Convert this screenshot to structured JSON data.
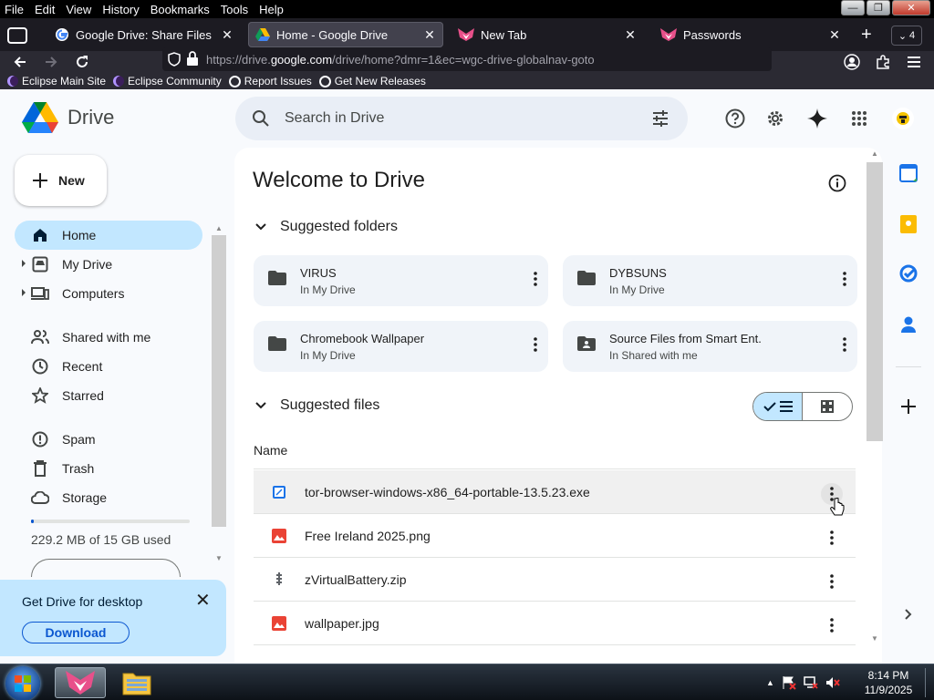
{
  "menubar": {
    "items": [
      "File",
      "Edit",
      "View",
      "History",
      "Bookmarks",
      "Tools",
      "Help"
    ]
  },
  "tabs": [
    {
      "title": "Google Drive: Share Files Online",
      "active": false
    },
    {
      "title": "Home - Google Drive",
      "active": true
    },
    {
      "title": "New Tab",
      "active": false
    },
    {
      "title": "Passwords",
      "active": false
    }
  ],
  "tab_count": "4",
  "urlbar": {
    "url_prefix": "https://drive.",
    "url_domain": "google.com",
    "url_rest": "/drive/home?dmr=1&ec=wgc-drive-globalnav-goto"
  },
  "bookmarks": [
    "Eclipse Main Site",
    "Eclipse Community",
    "Report Issues",
    "Get New Releases"
  ],
  "drive": {
    "logo_text": "Drive",
    "search_placeholder": "Search in Drive",
    "new_label": "New",
    "nav": [
      {
        "label": "Home",
        "icon": "home-icon",
        "selected": true
      },
      {
        "label": "My Drive",
        "icon": "my-drive-icon",
        "expandable": true
      },
      {
        "label": "Computers",
        "icon": "computers-icon",
        "expandable": true
      },
      {
        "label": "Shared with me",
        "icon": "shared-icon"
      },
      {
        "label": "Recent",
        "icon": "clock-icon"
      },
      {
        "label": "Starred",
        "icon": "star-icon"
      },
      {
        "label": "Spam",
        "icon": "spam-icon"
      },
      {
        "label": "Trash",
        "icon": "trash-icon"
      },
      {
        "label": "Storage",
        "icon": "cloud-icon"
      }
    ],
    "storage_text": "229.2 MB of 15 GB used",
    "storage_fraction": 0.015,
    "promo": {
      "title": "Get Drive for desktop",
      "download_label": "Download"
    },
    "welcome": "Welcome to Drive",
    "suggested_folders_label": "Suggested folders",
    "folders": [
      {
        "name": "VIRUS",
        "location": "In My Drive",
        "icon": "folder-icon"
      },
      {
        "name": "DYBSUNS",
        "location": "In My Drive",
        "icon": "folder-icon"
      },
      {
        "name": "Chromebook Wallpaper",
        "location": "In My Drive",
        "icon": "folder-icon"
      },
      {
        "name": "Source Files from Smart Ent.",
        "location": "In Shared with me",
        "icon": "shared-folder-icon"
      }
    ],
    "suggested_files_label": "Suggested files",
    "column_name": "Name",
    "files": [
      {
        "name": "tor-browser-windows-x86_64-portable-13.5.23.exe",
        "icon": "exe-icon"
      },
      {
        "name": "Free Ireland 2025.png",
        "icon": "image-icon"
      },
      {
        "name": "zVirtualBattery.zip",
        "icon": "zip-icon"
      },
      {
        "name": "wallpaper.jpg",
        "icon": "image-icon"
      }
    ]
  },
  "taskbar": {
    "time": "8:14 PM",
    "date": "11/9/2025"
  },
  "colors": {
    "accent": "#0b57d0",
    "selected_nav": "#c2e7ff",
    "search_bg": "#e9eef6",
    "image_red": "#ea4335"
  }
}
